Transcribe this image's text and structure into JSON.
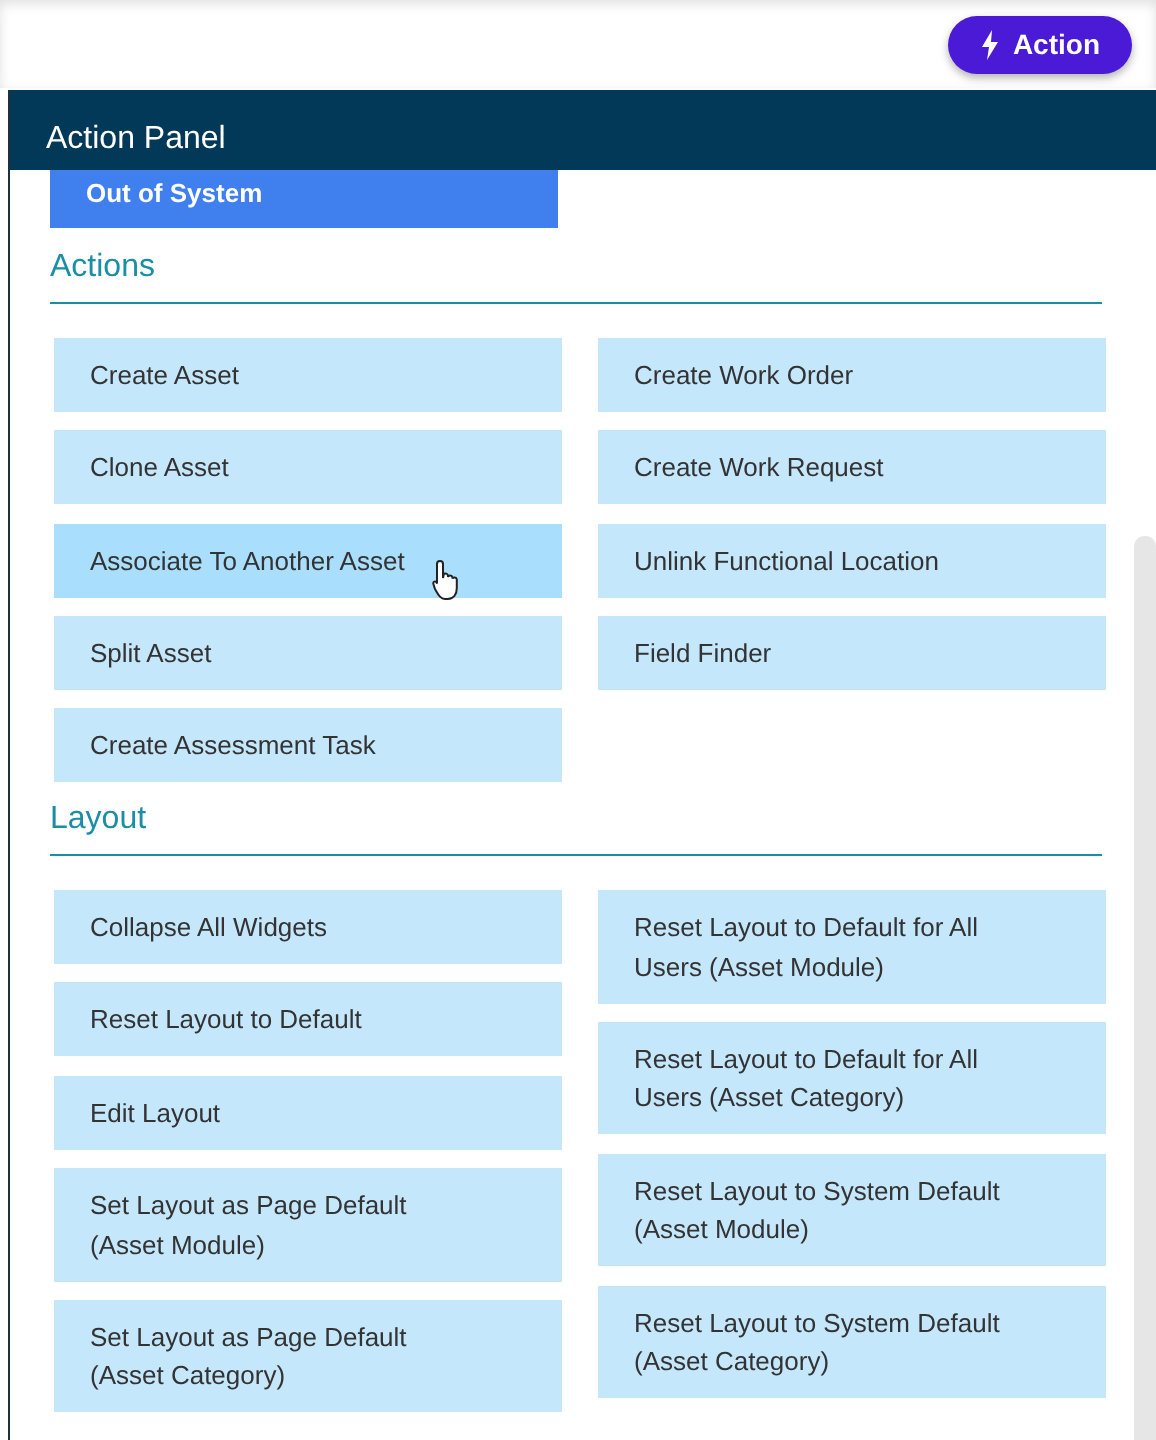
{
  "top_bar": {
    "action_button": "Action"
  },
  "panel": {
    "title": "Action Panel",
    "status_button": "Out of System",
    "sections": [
      {
        "title": "Actions",
        "columns": [
          [
            {
              "label": "Create Asset",
              "hovered": false
            },
            {
              "label": "Clone Asset",
              "hovered": false
            },
            {
              "label": "Associate To Another Asset",
              "hovered": true
            },
            {
              "label": "Split Asset",
              "hovered": false
            },
            {
              "label": "Create Assessment Task",
              "hovered": false
            }
          ],
          [
            {
              "label": "Create Work Order",
              "hovered": false
            },
            {
              "label": "Create Work Request",
              "hovered": false
            },
            {
              "label": "Unlink Functional Location",
              "hovered": false
            },
            {
              "label": "Field Finder",
              "hovered": false
            }
          ]
        ]
      },
      {
        "title": "Layout",
        "columns": [
          [
            {
              "label": "Collapse All Widgets",
              "hovered": false
            },
            {
              "label": "Reset Layout to Default",
              "hovered": false
            },
            {
              "label": "Edit Layout",
              "hovered": false
            },
            {
              "label": "Set Layout as Page Default (Asset Module)",
              "hovered": false
            },
            {
              "label": "Set Layout as Page Default (Asset Category)",
              "hovered": false
            }
          ],
          [
            {
              "label": "Reset Layout to Default for All Users (Asset Module)",
              "hovered": false
            },
            {
              "label": "Reset Layout to Default for All Users (Asset Category)",
              "hovered": false
            },
            {
              "label": "Reset Layout to System Default (Asset Module)",
              "hovered": false
            },
            {
              "label": "Reset Layout to System Default (Asset Category)",
              "hovered": false
            }
          ]
        ]
      }
    ]
  }
}
